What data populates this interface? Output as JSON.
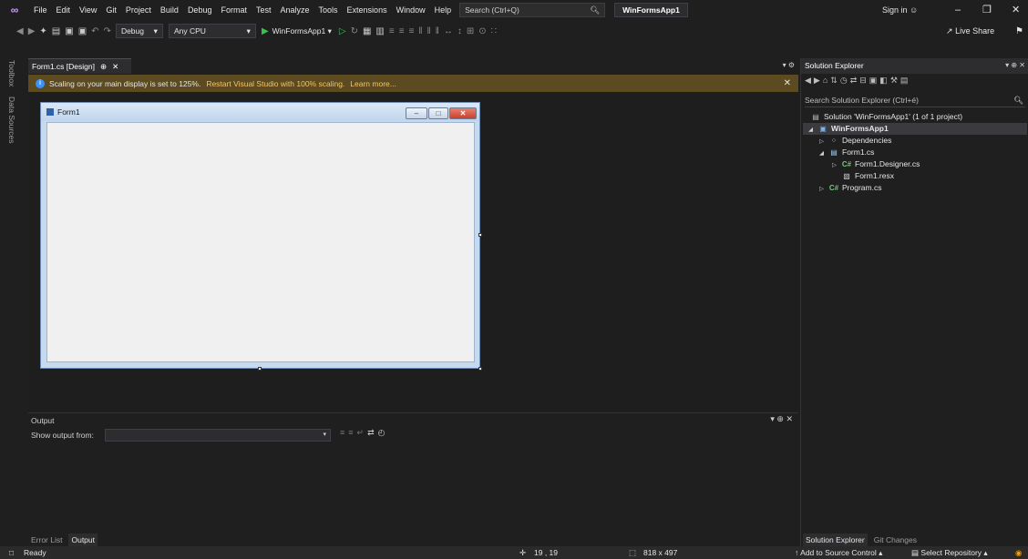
{
  "menubar": {
    "items": [
      "File",
      "Edit",
      "View",
      "Git",
      "Project",
      "Build",
      "Debug",
      "Format",
      "Test",
      "Analyze",
      "Tools",
      "Extensions",
      "Window",
      "Help"
    ],
    "search_placeholder": "Search (Ctrl+Q)",
    "solution_name": "WinFormsApp1",
    "sign_in": "Sign in"
  },
  "toolbar": {
    "configuration": "Debug",
    "platform": "Any CPU",
    "start_target": "WinFormsApp1",
    "live_share": "Live Share"
  },
  "left_rail": {
    "tabs": [
      "Toolbox",
      "Data Sources"
    ]
  },
  "document_tab": {
    "label": "Form1.cs [Design]"
  },
  "infobar": {
    "message": "Scaling on your main display is set to 125%.",
    "link_restart": "Restart Visual Studio with 100% scaling.",
    "link_learn": "Learn more..."
  },
  "designer": {
    "form_title": "Form1"
  },
  "output": {
    "title": "Output",
    "show_from_label": "Show output from:",
    "show_from_value": ""
  },
  "bottom_tabs": [
    "Error List",
    "Output"
  ],
  "solution_explorer": {
    "title": "Solution Explorer",
    "search_placeholder": "Search Solution Explorer (Ctrl+é)",
    "tree": [
      {
        "label": "Solution 'WinFormsApp1' (1 of 1 project)",
        "icon": "solution-icon"
      },
      {
        "label": "WinFormsApp1",
        "icon": "project-icon"
      },
      {
        "label": "Dependencies",
        "icon": "dependencies-icon"
      },
      {
        "label": "Form1.cs",
        "icon": "form-icon"
      },
      {
        "label": "Form1.Designer.cs",
        "icon": "csharp-icon"
      },
      {
        "label": "Form1.resx",
        "icon": "resx-icon"
      },
      {
        "label": "Program.cs",
        "icon": "csharp-icon"
      }
    ],
    "bottom_tabs": [
      "Solution Explorer",
      "Git Changes"
    ]
  },
  "statusbar": {
    "ready": "Ready",
    "position": "19 , 19",
    "size": "818 x 497",
    "add_source_control": "Add to Source Control",
    "select_repository": "Select Repository"
  },
  "colors": {
    "accent_purple": "#c9a0ff",
    "infobar_bg": "#5c4a20",
    "info_link": "#f2c56b",
    "play_green": "#39c14b"
  }
}
